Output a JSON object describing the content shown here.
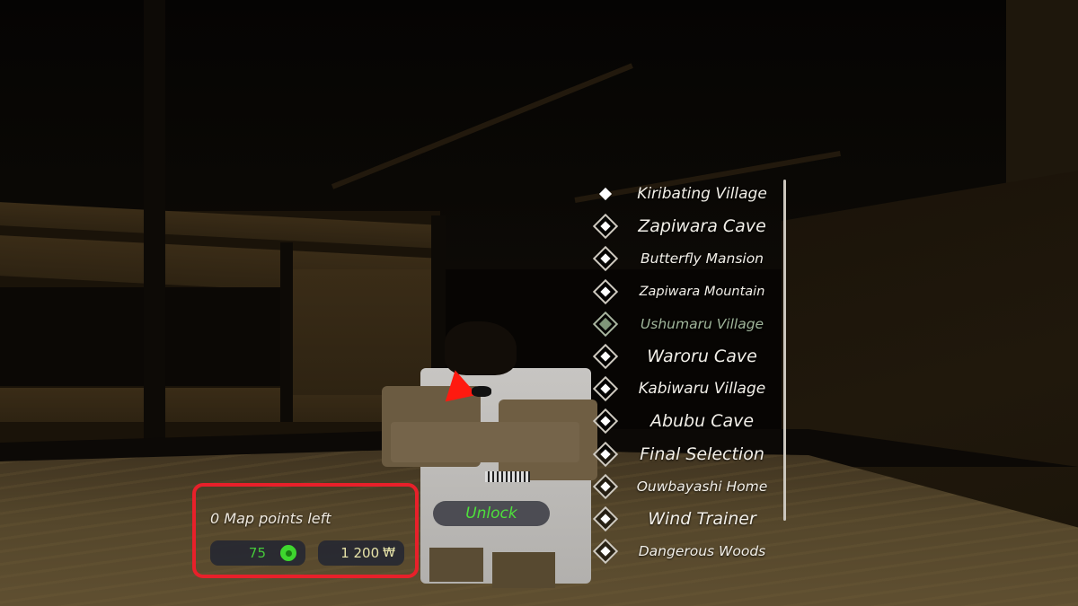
{
  "locations": {
    "items": [
      {
        "label": "Kiribating Village",
        "icon": "location-dot-icon",
        "state": "selected"
      },
      {
        "label": "Zapiwara Cave",
        "icon": "diamond-icon",
        "state": "normal"
      },
      {
        "label": "Butterfly Mansion",
        "icon": "diamond-icon",
        "state": "normal"
      },
      {
        "label": "Zapiwara Mountain",
        "icon": "diamond-icon",
        "state": "normal"
      },
      {
        "label": "Ushumaru Village",
        "icon": "diamond-icon",
        "state": "current"
      },
      {
        "label": "Waroru Cave",
        "icon": "diamond-icon",
        "state": "normal"
      },
      {
        "label": "Kabiwaru Village",
        "icon": "diamond-icon",
        "state": "normal"
      },
      {
        "label": "Abubu Cave",
        "icon": "diamond-icon",
        "state": "normal"
      },
      {
        "label": "Final Selection",
        "icon": "diamond-icon",
        "state": "normal"
      },
      {
        "label": "Ouwbayashi Home",
        "icon": "diamond-icon",
        "state": "normal"
      },
      {
        "label": "Wind Trainer",
        "icon": "diamond-icon",
        "state": "normal"
      },
      {
        "label": "Dangerous Woods",
        "icon": "diamond-icon",
        "state": "normal"
      }
    ]
  },
  "points_panel": {
    "title": "0 Map points left",
    "gems": {
      "value": "75",
      "icon": "gem-icon"
    },
    "yen": {
      "value": "1 200",
      "symbol": "₩",
      "icon": "yen-icon"
    },
    "highlight_color": "#e8202a"
  },
  "unlock_button": {
    "label": "Unlock",
    "color": "#4ee03c"
  },
  "colors": {
    "current_location": "#9fb59a",
    "gem_text": "#46c93a",
    "yen_text": "#e7e3a8"
  }
}
